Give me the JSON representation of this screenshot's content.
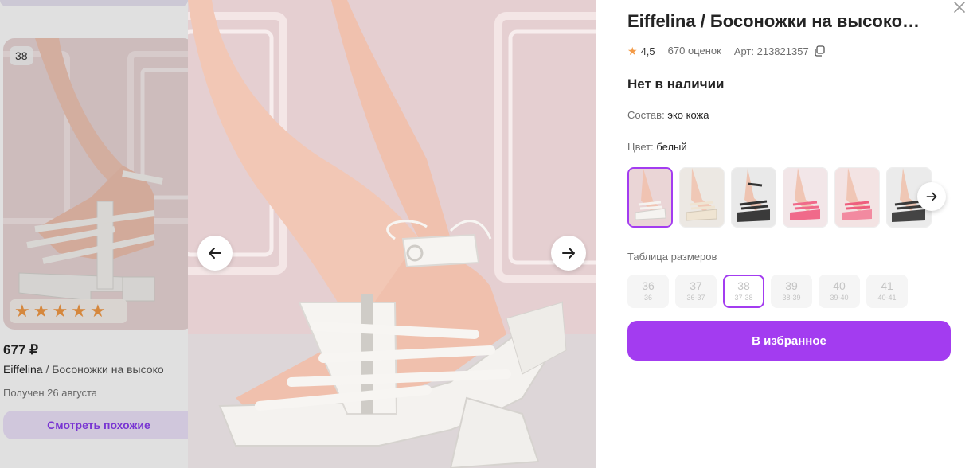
{
  "background_card": {
    "size_badge": "38",
    "rating_stars": 5,
    "price": "677 ₽",
    "brand": "Eiffelina",
    "separator": " / ",
    "name": "Босоножки на высоко",
    "received": "Получен 26 августа",
    "similar_button": "Смотреть похожие"
  },
  "product": {
    "title": "Eiffelina / Босоножки на высоко…",
    "rating": "4,5",
    "reviews": "670 оценок",
    "article": "Арт: 213821357",
    "stock_status": "Нет в наличии",
    "composition_label": "Состав:",
    "composition_value": "эко кожа",
    "color_label": "Цвет:",
    "color_value": "белый",
    "size_table_link": "Таблица размеров",
    "sizes": [
      {
        "size": "36",
        "ru": "36"
      },
      {
        "size": "37",
        "ru": "36-37"
      },
      {
        "size": "38",
        "ru": "37-38"
      },
      {
        "size": "39",
        "ru": "38-39"
      },
      {
        "size": "40",
        "ru": "39-40"
      },
      {
        "size": "41",
        "ru": "40-41"
      }
    ],
    "selected_size_index": 2,
    "favorite_button": "В избранное"
  },
  "colors": {
    "accent": "#a33cf0",
    "star": "#f39a46",
    "text": "#242424",
    "muted": "#6e6e6e"
  },
  "icons": {
    "prev": "arrow-left-icon",
    "next": "arrow-right-icon",
    "close": "close-icon",
    "copy": "copy-icon",
    "star": "star-icon"
  }
}
